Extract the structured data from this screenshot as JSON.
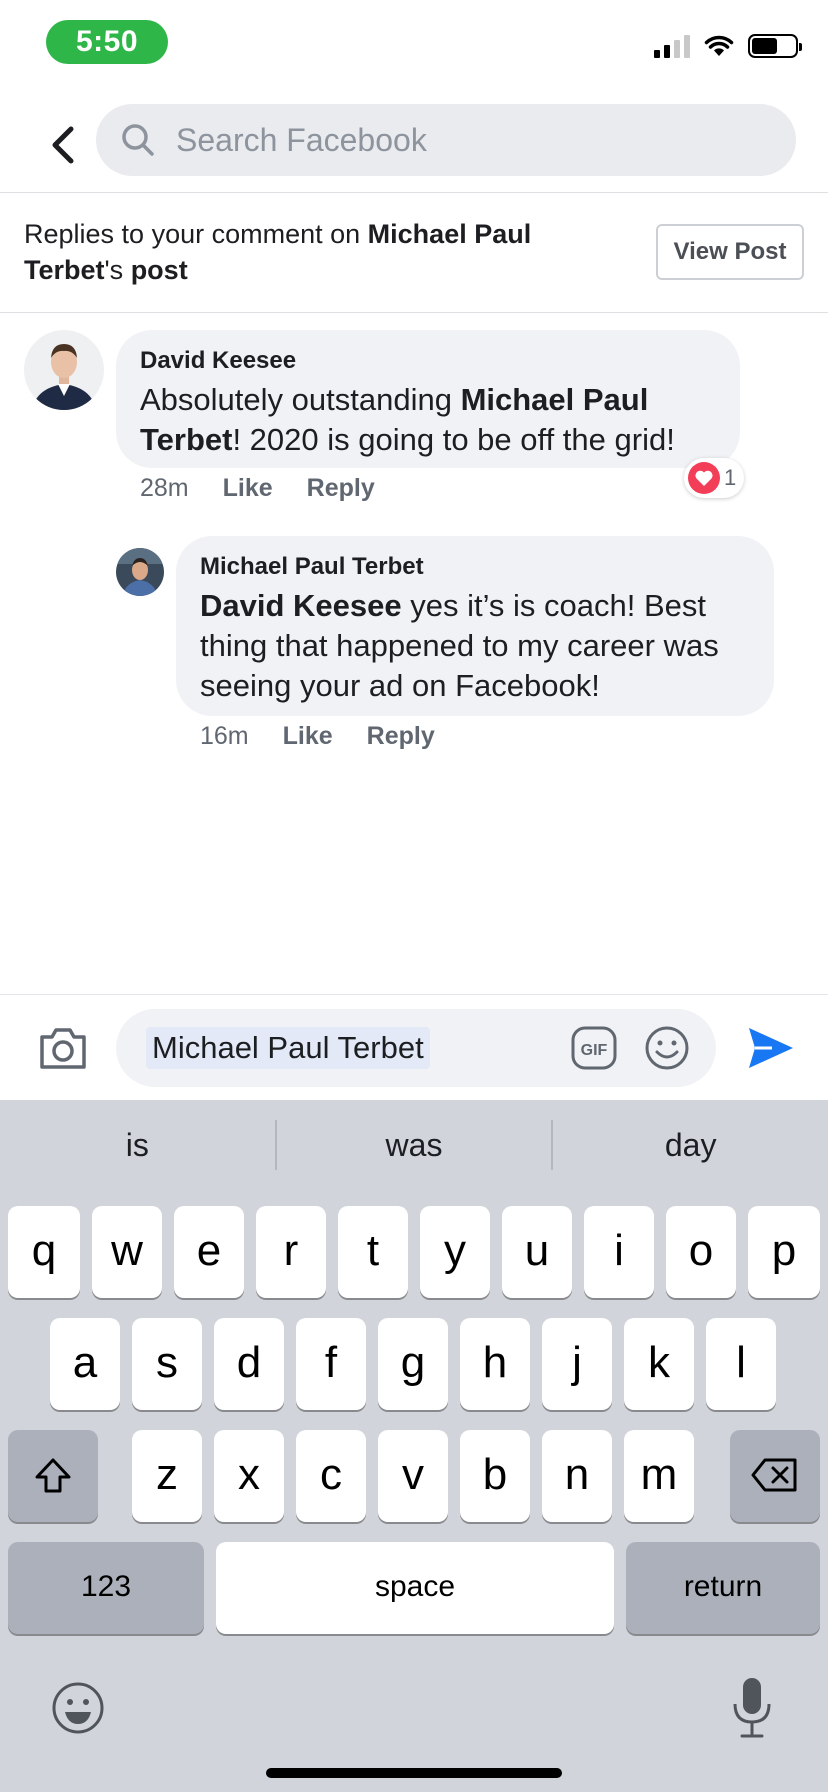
{
  "status_bar": {
    "time": "5:50"
  },
  "header": {
    "search_placeholder": "Search Facebook"
  },
  "context": {
    "prefix": "Replies to your comment on ",
    "name": "Michael Paul Terbet",
    "suffix_plain": "'s",
    "suffix_bold": "post",
    "view_post_label": "View Post"
  },
  "comments": [
    {
      "author": "David Keesee",
      "body_pre": "Absolutely outstanding ",
      "body_mention": "Michael Paul Terbet",
      "body_post": "! 2020 is going to be off the grid!",
      "time": "28m",
      "like_label": "Like",
      "reply_label": "Reply",
      "reaction_count": "1"
    },
    {
      "author": "Michael Paul Terbet",
      "body_mention": "David Keesee",
      "body_post": " yes it’s is coach! Best thing that happened to my career was seeing your ad on Facebook!",
      "time": "16m",
      "like_label": "Like",
      "reply_label": "Reply"
    }
  ],
  "composer": {
    "value": "Michael Paul Terbet"
  },
  "keyboard": {
    "suggestions": [
      "is",
      "was",
      "day"
    ],
    "row1": [
      "q",
      "w",
      "e",
      "r",
      "t",
      "y",
      "u",
      "i",
      "o",
      "p"
    ],
    "row2": [
      "a",
      "s",
      "d",
      "f",
      "g",
      "h",
      "j",
      "k",
      "l"
    ],
    "row3": [
      "z",
      "x",
      "c",
      "v",
      "b",
      "n",
      "m"
    ],
    "numbers_label": "123",
    "space_label": "space",
    "return_label": "return"
  },
  "colors": {
    "accent": "#1877f2",
    "heart": "#f33e58",
    "time_pill": "#2fb648"
  },
  "icons": [
    "back-icon",
    "search-icon",
    "camera-icon",
    "gif-icon",
    "emoji-icon",
    "send-icon",
    "shift-icon",
    "delete-icon",
    "emoji-keyboard-icon",
    "microphone-icon"
  ]
}
